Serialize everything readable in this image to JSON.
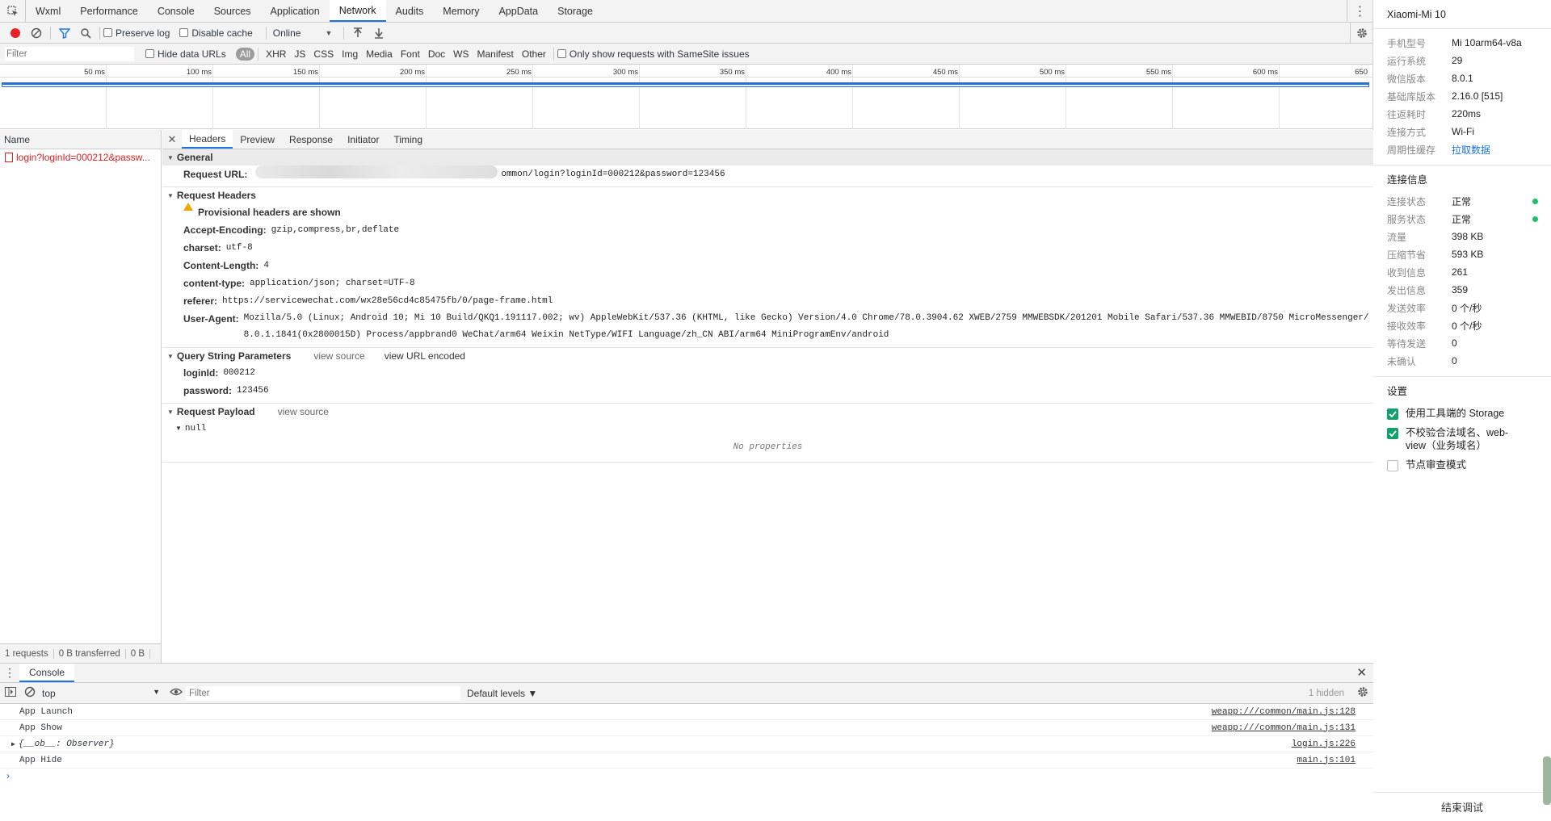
{
  "top_tabs": [
    "Wxml",
    "Performance",
    "Console",
    "Sources",
    "Application",
    "Network",
    "Audits",
    "Memory",
    "AppData",
    "Storage"
  ],
  "toolbar": {
    "preserve_log": "Preserve log",
    "disable_cache": "Disable cache",
    "throttle": "Online"
  },
  "filterbar": {
    "placeholder": "Filter",
    "hide_data_urls": "Hide data URLs",
    "types": [
      "All",
      "XHR",
      "JS",
      "CSS",
      "Img",
      "Media",
      "Font",
      "Doc",
      "WS",
      "Manifest",
      "Other"
    ],
    "samesite": "Only show requests with SameSite issues"
  },
  "timeline_ticks": [
    "50 ms",
    "100 ms",
    "150 ms",
    "200 ms",
    "250 ms",
    "300 ms",
    "350 ms",
    "400 ms",
    "450 ms",
    "500 ms",
    "550 ms",
    "600 ms",
    "650"
  ],
  "request_list": {
    "header": "Name",
    "rows": [
      "login?loginId=000212&passw..."
    ],
    "status": [
      "1 requests",
      "0 B transferred",
      "0 B"
    ]
  },
  "detail_tabs": [
    "Headers",
    "Preview",
    "Response",
    "Initiator",
    "Timing"
  ],
  "general": {
    "title": "General",
    "request_url_key": "Request URL:",
    "request_url_tail": "ommon/login?loginId=000212&password=123456"
  },
  "request_headers": {
    "title": "Request Headers",
    "provisional": "Provisional headers are shown",
    "items": [
      {
        "k": "Accept-Encoding:",
        "v": "gzip,compress,br,deflate"
      },
      {
        "k": "charset:",
        "v": "utf-8"
      },
      {
        "k": "Content-Length:",
        "v": "4"
      },
      {
        "k": "content-type:",
        "v": "application/json; charset=UTF-8"
      },
      {
        "k": "referer:",
        "v": "https://servicewechat.com/wx28e56cd4c85475fb/0/page-frame.html"
      },
      {
        "k": "User-Agent:",
        "v": "Mozilla/5.0 (Linux; Android 10; Mi 10 Build/QKQ1.191117.002; wv) AppleWebKit/537.36 (KHTML, like Gecko) Version/4.0 Chrome/78.0.3904.62 XWEB/2759 MMWEBSDK/201201 Mobile Safari/537.36 MMWEBID/8750 MicroMessenger/8.0.1.1841(0x2800015D) Process/appbrand0 WeChat/arm64 Weixin NetType/WIFI Language/zh_CN ABI/arm64 MiniProgramEnv/android"
      }
    ]
  },
  "query": {
    "title": "Query String Parameters",
    "view_source": "view source",
    "view_encoded": "view URL encoded",
    "items": [
      {
        "k": "loginId:",
        "v": "000212"
      },
      {
        "k": "password:",
        "v": "123456"
      }
    ]
  },
  "payload": {
    "title": "Request Payload",
    "view_source": "view source",
    "value": "null",
    "empty": "No properties"
  },
  "console": {
    "tab": "Console",
    "context": "top",
    "filter_placeholder": "Filter",
    "levels": "Default levels ▼",
    "hidden": "1 hidden",
    "lines": [
      {
        "msg": "App Launch",
        "src": "weapp:///common/main.js:128"
      },
      {
        "msg": "App Show",
        "src": "weapp:///common/main.js:131"
      },
      {
        "msg": "{__ob__: Observer}",
        "src": "login.js:226"
      },
      {
        "msg": "App Hide",
        "src": "main.js:101"
      }
    ]
  },
  "side": {
    "device": "Xiaomi-Mi 10",
    "device_info": [
      {
        "label": "手机型号",
        "value": "Mi 10arm64-v8a"
      },
      {
        "label": "运行系统",
        "value": "29"
      },
      {
        "label": "微信版本",
        "value": "8.0.1"
      },
      {
        "label": "基础库版本",
        "value": "2.16.0 [515]"
      },
      {
        "label": "往返耗时",
        "value": "220ms"
      },
      {
        "label": "连接方式",
        "value": "Wi-Fi"
      },
      {
        "label": "周期性缓存",
        "value": "拉取数据"
      }
    ],
    "conn_title": "连接信息",
    "conn_info": [
      {
        "label": "连接状态",
        "value": "正常"
      },
      {
        "label": "服务状态",
        "value": "正常"
      },
      {
        "label": "流量",
        "value": "398 KB"
      },
      {
        "label": "压缩节省",
        "value": "593 KB"
      },
      {
        "label": "收到信息",
        "value": "261"
      },
      {
        "label": "发出信息",
        "value": "359"
      },
      {
        "label": "发送效率",
        "value": "0 个/秒"
      },
      {
        "label": "接收效率",
        "value": "0 个/秒"
      },
      {
        "label": "等待发送",
        "value": "0"
      },
      {
        "label": "未确认",
        "value": "0"
      }
    ],
    "settings_title": "设置",
    "settings": [
      {
        "label": "使用工具端的 Storage",
        "checked": true
      },
      {
        "label": "不校验合法域名、web-view（业务域名）",
        "checked": true
      },
      {
        "label": "节点审查模式",
        "checked": false
      }
    ],
    "end_button": "结束调试",
    "status_ok_color": "#19c26a"
  }
}
